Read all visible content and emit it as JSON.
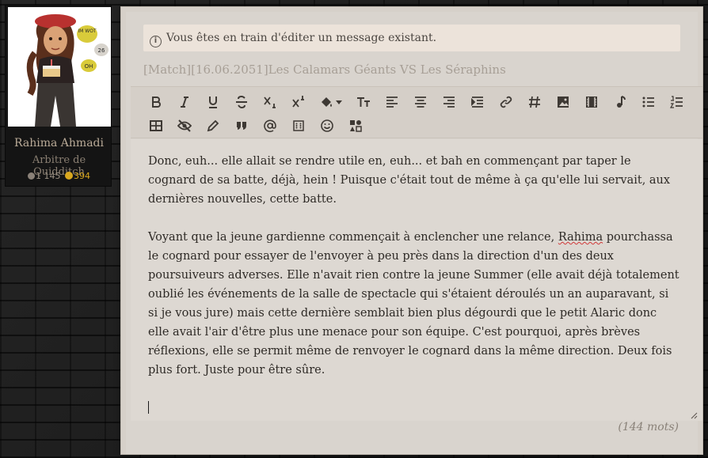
{
  "profile": {
    "name": "Rahima Ahmadi",
    "role": "Arbitre de Quidditch",
    "messages": "1 145",
    "coins": "394",
    "avatar_bubbles": [
      "IM WOT",
      "26",
      "OH"
    ]
  },
  "notice": {
    "text": "Vous êtes en train d'éditer un message existant."
  },
  "subject": "[Match][16.06.2051]Les Calamars Géants VS Les Séraphins",
  "toolbar": {
    "row1": [
      "bold-icon",
      "italic-icon",
      "underline-icon",
      "strikethrough-icon",
      "subscript-icon",
      "superscript-icon",
      "fill-color-icon",
      "font-size-icon",
      "align-left-icon",
      "align-center-icon",
      "align-right-icon",
      "indent-icon",
      "link-icon",
      "hashtag-icon",
      "image-icon",
      "video-icon",
      "music-icon",
      "bullet-list-icon",
      "numbered-list-icon"
    ],
    "row2": [
      "table-icon",
      "hide-icon",
      "pencil-icon",
      "quote-icon",
      "mention-icon",
      "dice-icon",
      "smiley-icon",
      "color-palette-icon"
    ]
  },
  "editor": {
    "paragraph1": "Donc, euh... elle allait se rendre utile en, euh... et bah en commençant par taper le cognard de sa batte, déjà, hein ! Puisque c'était tout de même à ça qu'elle lui servait, aux dernières nouvelles, cette batte.",
    "paragraph2_before": "Voyant que la jeune gardienne commençait à enclencher une relance, ",
    "paragraph2_spell": "Rahima",
    "paragraph2_after": " pourchassa le cognard pour essayer de l'envoyer à peu près dans la direction d'un des deux poursuiveurs adverses. Elle n'avait rien contre la jeune Summer (elle avait déjà totalement oublié les événements de la salle de spectacle qui s'étaient déroulés un an auparavant, si si je vous jure) mais cette dernière semblait bien plus dégourdi que le petit Alaric donc elle avait l'air d'être plus une menace pour son équipe. C'est pourquoi, après brèves réflexions, elle se permit même de renvoyer le cognard dans la même direction. Deux fois plus fort. Juste pour être sûre."
  },
  "word_count": "(144 mots)"
}
